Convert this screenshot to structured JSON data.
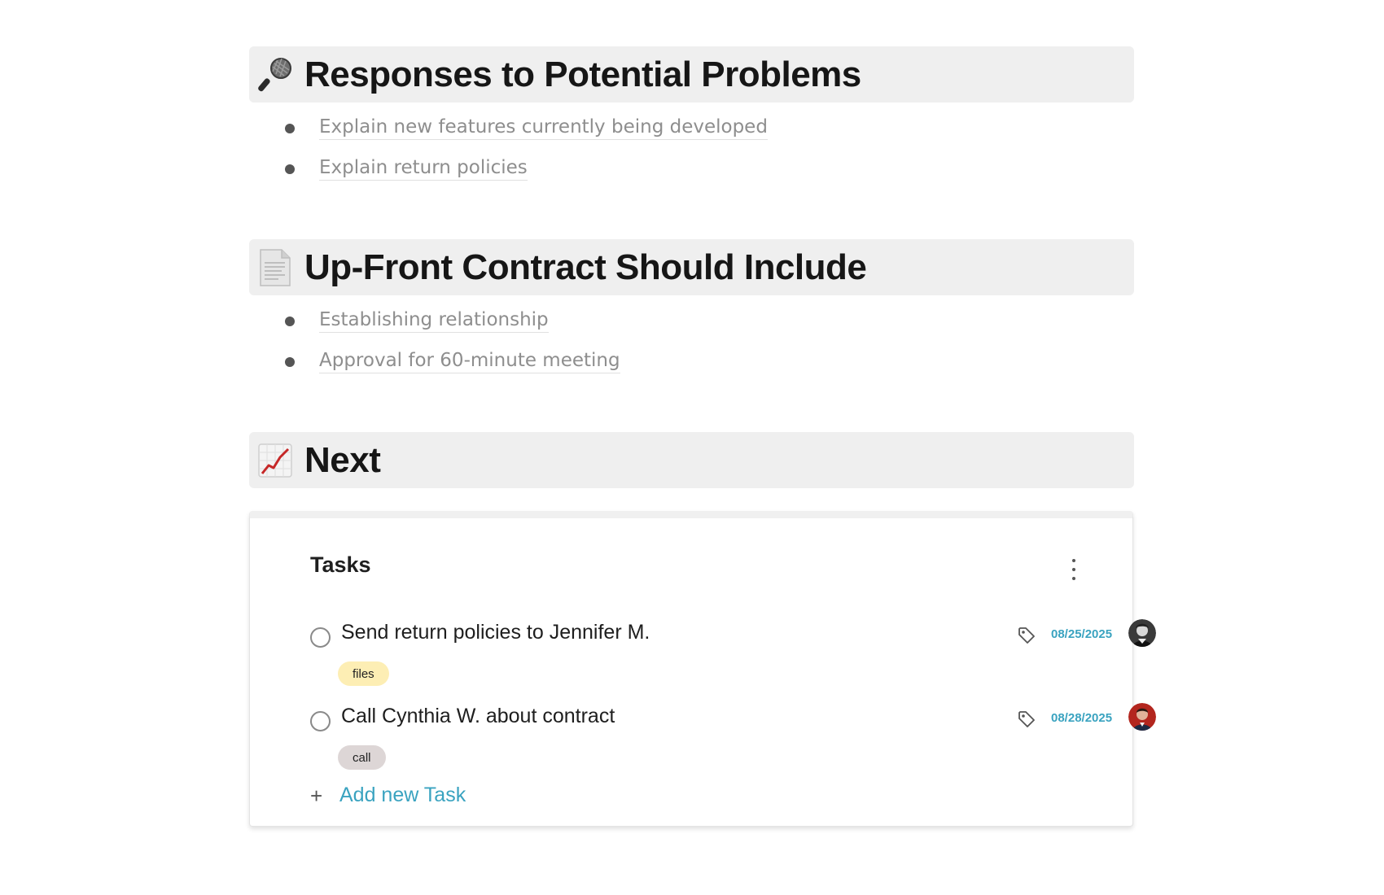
{
  "sections": [
    {
      "icon": "microphone-icon",
      "title": "Responses to Potential Problems",
      "items": [
        "Explain new features currently being developed",
        "Explain return policies"
      ]
    },
    {
      "icon": "page-icon",
      "title": "Up-Front Contract Should Include",
      "items": [
        "Establishing relationship",
        "Approval for 60-minute meeting"
      ]
    },
    {
      "icon": "chart-increasing-icon",
      "title": "Next",
      "items": []
    }
  ],
  "tasks_card": {
    "title": "Tasks",
    "menu_icon": "more-vertical-icon",
    "tasks": [
      {
        "label": "Send return policies to Jennifer M.",
        "tag": "files",
        "tag_color": "#fdeeb4",
        "date": "08/25/2025",
        "avatar": "user-avatar-grayscale"
      },
      {
        "label": "Call Cynthia W. about contract",
        "tag": "call",
        "tag_color": "#ddd6d6",
        "date": "08/28/2025",
        "avatar": "user-avatar-red"
      }
    ],
    "add_label": "Add new Task",
    "add_icon": "plus-icon"
  },
  "colors": {
    "accent": "#3aa3c0",
    "heading_bg": "#efefef",
    "muted_text": "#8e8e8e"
  }
}
